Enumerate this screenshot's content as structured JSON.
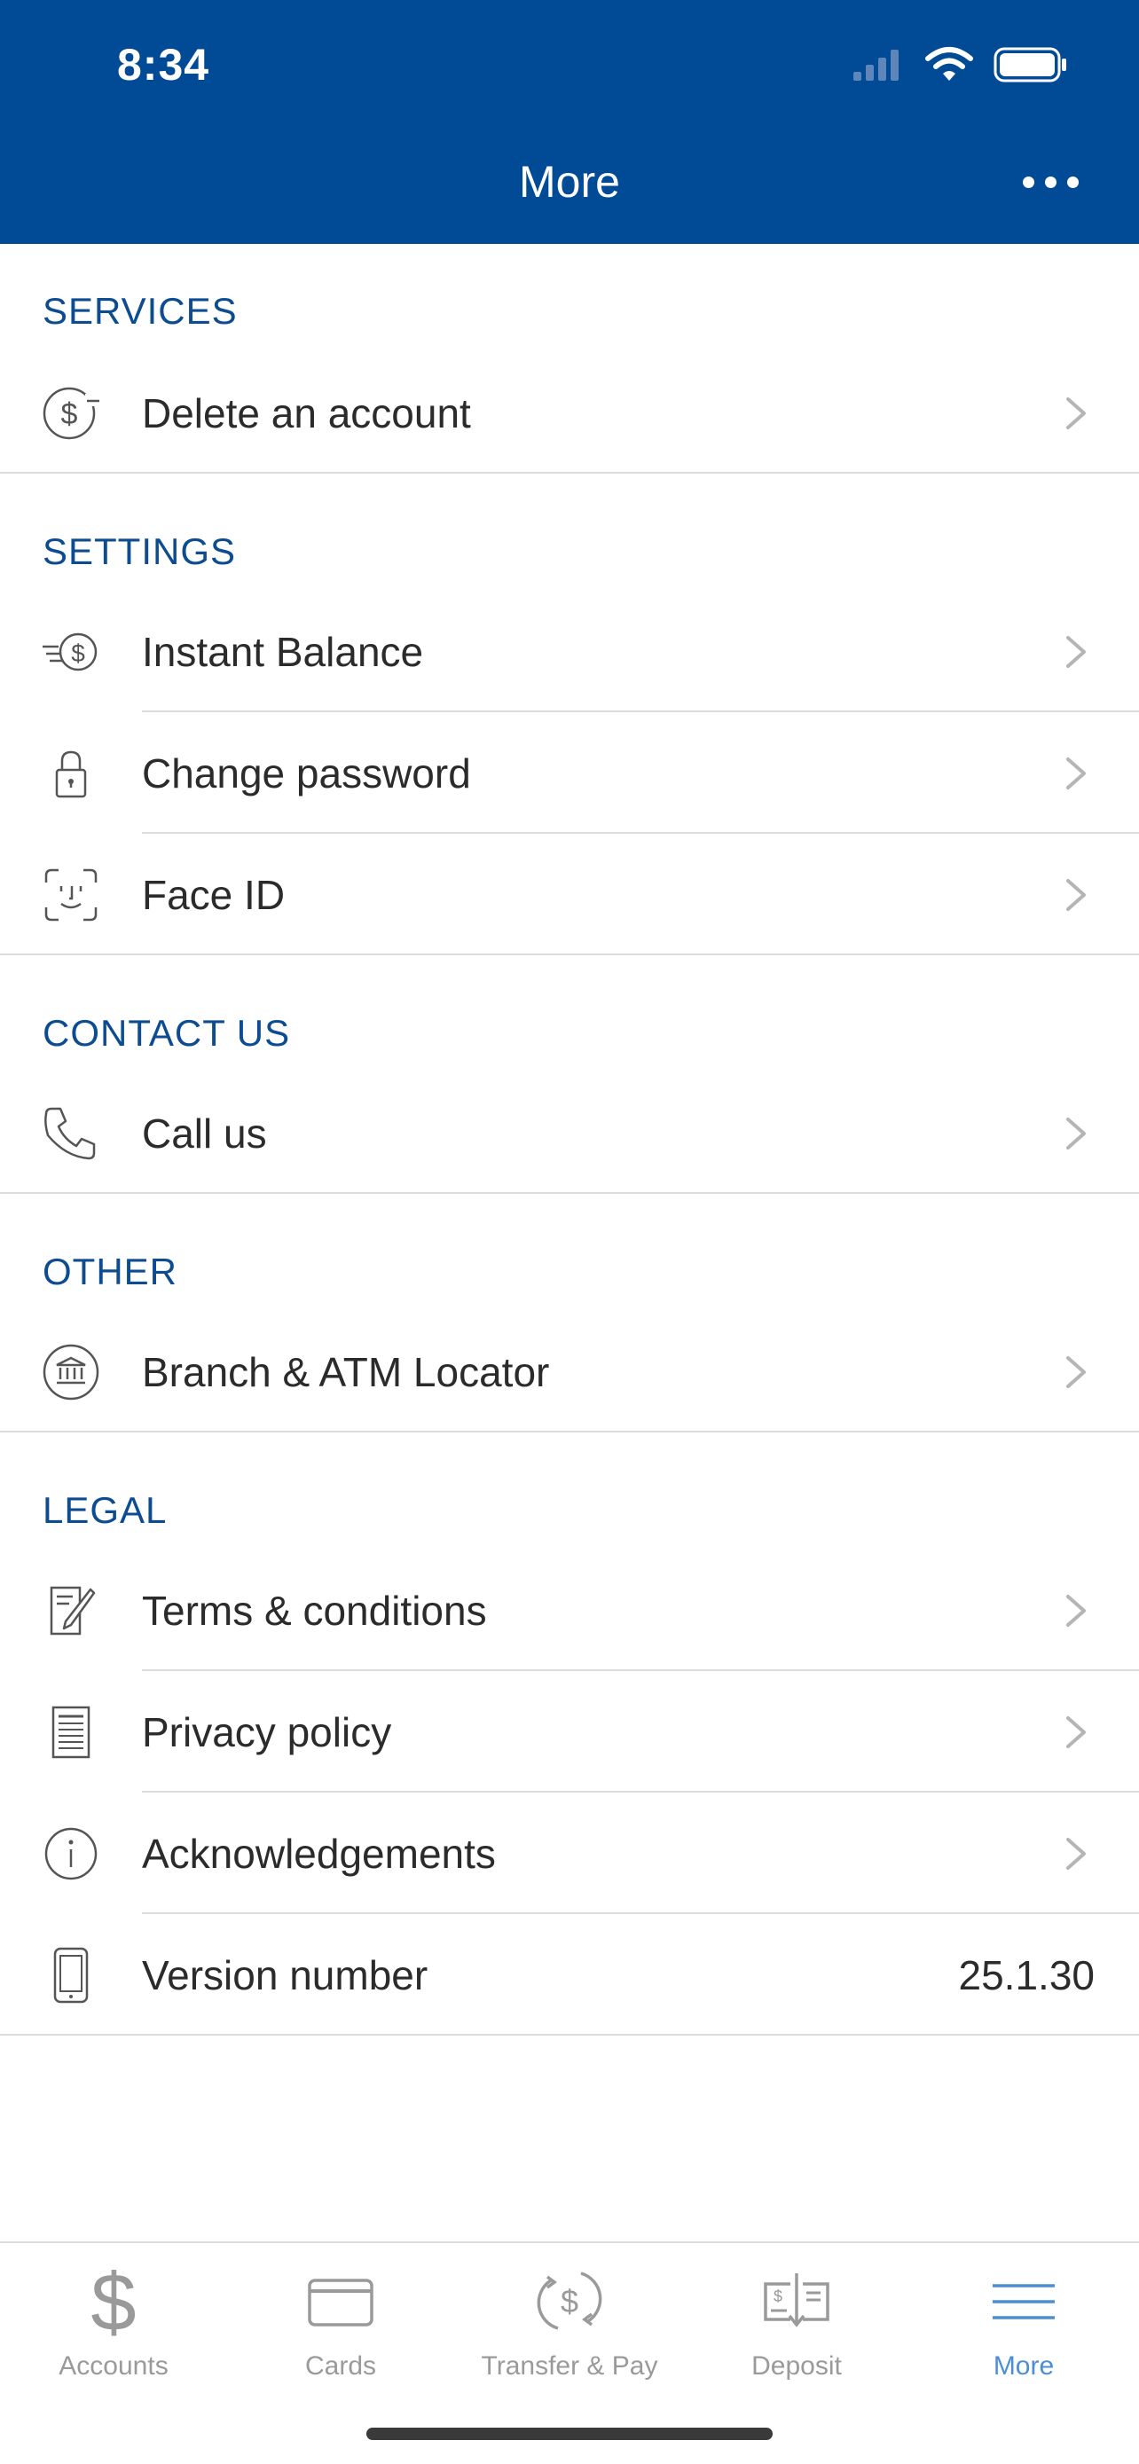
{
  "status_bar": {
    "time": "8:34"
  },
  "header": {
    "title": "More"
  },
  "sections": [
    {
      "title": "SERVICES",
      "items": [
        {
          "label": "Delete an account",
          "icon": "dollar-minus-icon"
        }
      ]
    },
    {
      "title": "SETTINGS",
      "items": [
        {
          "label": "Instant Balance",
          "icon": "instant-balance-icon"
        },
        {
          "label": "Change password",
          "icon": "lock-icon"
        },
        {
          "label": "Face ID",
          "icon": "face-id-icon"
        }
      ]
    },
    {
      "title": "CONTACT US",
      "items": [
        {
          "label": "Call us",
          "icon": "phone-icon"
        }
      ]
    },
    {
      "title": "OTHER",
      "items": [
        {
          "label": "Branch & ATM Locator",
          "icon": "bank-icon"
        }
      ]
    },
    {
      "title": "LEGAL",
      "items": [
        {
          "label": "Terms & conditions",
          "icon": "document-edit-icon"
        },
        {
          "label": "Privacy policy",
          "icon": "document-list-icon"
        },
        {
          "label": "Acknowledgements",
          "icon": "info-icon"
        },
        {
          "label": "Version number",
          "value": "25.1.30",
          "icon": "phone-device-icon"
        }
      ]
    }
  ],
  "tabbar": [
    {
      "label": "Accounts",
      "icon": "dollar-icon"
    },
    {
      "label": "Cards",
      "icon": "card-icon"
    },
    {
      "label": "Transfer & Pay",
      "icon": "transfer-icon"
    },
    {
      "label": "Deposit",
      "icon": "check-deposit-icon"
    },
    {
      "label": "More",
      "icon": "menu-icon",
      "active": true
    }
  ],
  "colors": {
    "brand": "#004a96",
    "section_text": "#0d4c91",
    "active_tab": "#4a8fd6",
    "inactive_tab": "#9a9a9a"
  }
}
